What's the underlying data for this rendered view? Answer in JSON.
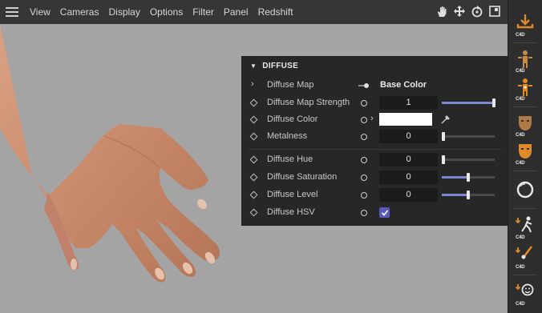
{
  "menu": {
    "items": [
      "View",
      "Cameras",
      "Display",
      "Options",
      "Filter",
      "Panel",
      "Redshift"
    ],
    "nav_icons": [
      "pan-hand-icon",
      "move-arrows-icon",
      "rotate-icon",
      "maximize-icon"
    ]
  },
  "panel": {
    "section_title": "DIFFUSE",
    "rows": [
      {
        "label": "Diffuse Map",
        "value": "Base Color"
      },
      {
        "label": "Diffuse Map Strength",
        "value": "1",
        "slider": 1.0
      },
      {
        "label": "Diffuse Color",
        "color": "#ffffff"
      },
      {
        "label": "Metalness",
        "value": "0",
        "slider": 0.0
      },
      {
        "label": "Diffuse Hue",
        "value": "0",
        "slider": 0.0
      },
      {
        "label": "Diffuse Saturation",
        "value": "0",
        "slider": 0.5
      },
      {
        "label": "Diffuse Level",
        "value": "0",
        "slider": 0.5
      },
      {
        "label": "Diffuse HSV",
        "checked": true
      }
    ]
  },
  "toolbar": {
    "badge": "C4D",
    "icons": [
      "import-c4d-icon",
      "character-rig-icon",
      "character-rig-highlight-icon",
      "mask-icon",
      "mask-orange-icon",
      "sphere-icon",
      "walk-icon",
      "paint-icon",
      "face-icon"
    ]
  },
  "colors": {
    "accent": "#7b88d0",
    "checkbox": "#5a5ab8",
    "viewport_bg": "#a4a4a4",
    "panel_bg": "#272727",
    "icon_orange": "#e08a2a"
  }
}
